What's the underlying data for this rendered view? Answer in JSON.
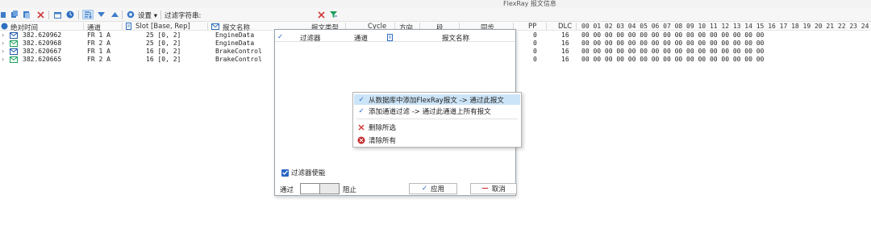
{
  "window": {
    "title": "FlexRay 报文信息"
  },
  "toolbar": {
    "settings_label": "设置",
    "filter_label": "过滤字符串:",
    "filter_value": "",
    "icons": [
      "pin-icon",
      "copy-icon",
      "paste-icon",
      "delete-icon",
      "calendar-icon",
      "clock-icon",
      "sort-icon",
      "filter-down-icon",
      "up-arrow-icon",
      "gear-icon",
      "clear-filter-icon",
      "funnel-icon"
    ]
  },
  "grid": {
    "headers": [
      "绝对时间",
      "通道",
      "Slot [Base, Rep]",
      "报文名称",
      "报文类型",
      "Cycle",
      "方向",
      "段",
      "同步",
      "PP",
      "DLC",
      "00 01 02 03 04 05 06 07 08 09 10 11 12 13 14 15 16 17 18 19 20 21 22 23 24"
    ],
    "rows": [
      {
        "time": "382.620962",
        "channel": "FR 1 A",
        "slot": "25 [0, 2]",
        "name": "EngineData",
        "pp": "0",
        "dlc": "16",
        "bytes": "00 00 00 00 00 00 00 00 00 00 00 00 00 00 00 00"
      },
      {
        "time": "382.620968",
        "channel": "FR 2 A",
        "slot": "25 [0, 2]",
        "name": "EngineData",
        "pp": "0",
        "dlc": "16",
        "bytes": "00 00 00 00 00 00 00 00 00 00 00 00 00 00 00 00"
      },
      {
        "time": "382.620667",
        "channel": "FR 1 A",
        "slot": "16 [0, 2]",
        "name": "BrakeControl",
        "pp": "0",
        "dlc": "16",
        "bytes": "00 00 00 00 00 00 00 00 00 00 00 00 00 00 00 00"
      },
      {
        "time": "382.620665",
        "channel": "FR 2 A",
        "slot": "16 [0, 2]",
        "name": "BrakeControl",
        "pp": "0",
        "dlc": "16",
        "bytes": "00 00 00 00 00 00 00 00 00 00 00 00 00 00 00 00"
      }
    ]
  },
  "filter_popup": {
    "headers": {
      "filter": "过滤器",
      "channel": "通道",
      "name": "报文名称"
    },
    "enable_label": "过滤器使能",
    "pass_label": "通过",
    "block_label": "阻止",
    "apply_label": "应用",
    "cancel_label": "取消"
  },
  "context_menu": {
    "items": [
      {
        "label": "从数据库中添加FlexRay报文 -> 通过此报文",
        "icon": "check-icon",
        "highlighted": true
      },
      {
        "label": "添加通道过滤 -> 通过此通道上所有报文",
        "icon": "check-icon",
        "highlighted": false
      },
      {
        "label": "删除所选",
        "icon": "x-icon",
        "highlighted": false
      },
      {
        "label": "清除所有",
        "icon": "error-circle-icon",
        "highlighted": false
      }
    ]
  },
  "colors": {
    "accent": "#2a66c3",
    "highlight": "#cce4f7",
    "delete": "#d23a3a",
    "envelope": "#1a9e5a"
  }
}
